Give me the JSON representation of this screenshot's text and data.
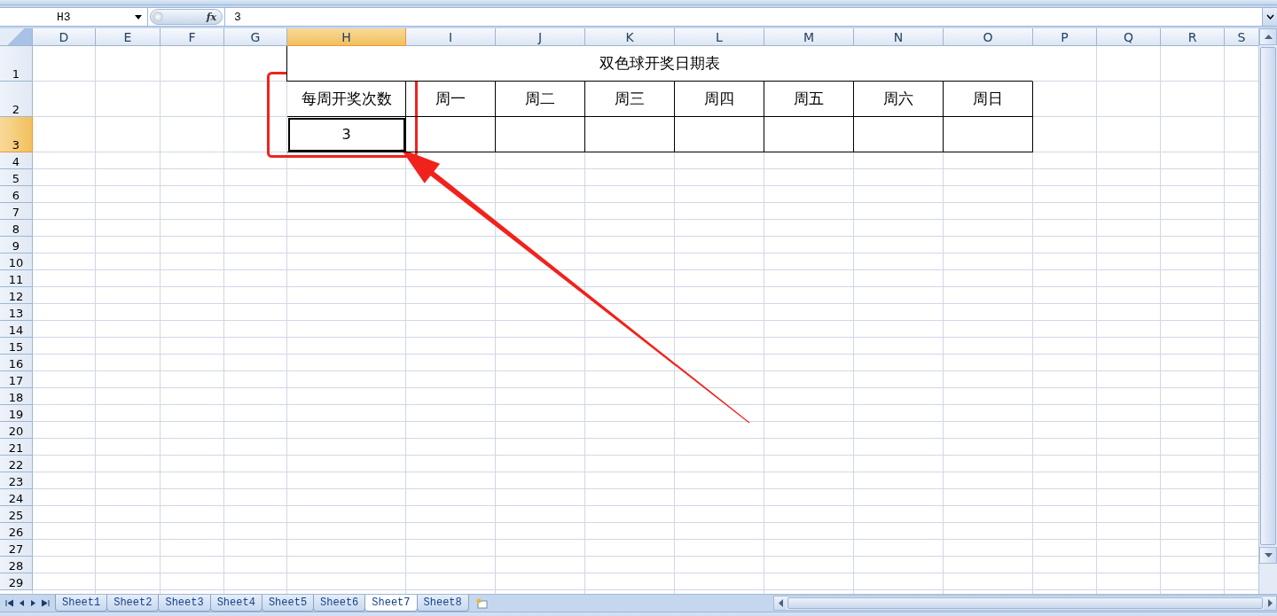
{
  "formula_bar": {
    "name_box": "H3",
    "function_label": "fx",
    "formula": "3"
  },
  "columns": [
    {
      "label": "D",
      "selected": false
    },
    {
      "label": "E",
      "selected": false
    },
    {
      "label": "F",
      "selected": false
    },
    {
      "label": "G",
      "selected": false
    },
    {
      "label": "H",
      "selected": true
    },
    {
      "label": "I",
      "selected": false
    },
    {
      "label": "J",
      "selected": false
    },
    {
      "label": "K",
      "selected": false
    },
    {
      "label": "L",
      "selected": false
    },
    {
      "label": "M",
      "selected": false
    },
    {
      "label": "N",
      "selected": false
    },
    {
      "label": "O",
      "selected": false
    },
    {
      "label": "P",
      "selected": false
    },
    {
      "label": "Q",
      "selected": false
    },
    {
      "label": "R",
      "selected": false
    },
    {
      "label": "S",
      "selected": false
    }
  ],
  "rows": [
    {
      "label": "1",
      "selected": false
    },
    {
      "label": "2",
      "selected": false
    },
    {
      "label": "3",
      "selected": true
    },
    {
      "label": "4",
      "selected": false
    },
    {
      "label": "5",
      "selected": false
    },
    {
      "label": "6",
      "selected": false
    },
    {
      "label": "7",
      "selected": false
    },
    {
      "label": "8",
      "selected": false
    },
    {
      "label": "9",
      "selected": false
    },
    {
      "label": "10",
      "selected": false
    },
    {
      "label": "11",
      "selected": false
    },
    {
      "label": "12",
      "selected": false
    },
    {
      "label": "13",
      "selected": false
    },
    {
      "label": "14",
      "selected": false
    },
    {
      "label": "15",
      "selected": false
    },
    {
      "label": "16",
      "selected": false
    },
    {
      "label": "17",
      "selected": false
    },
    {
      "label": "18",
      "selected": false
    },
    {
      "label": "19",
      "selected": false
    },
    {
      "label": "20",
      "selected": false
    },
    {
      "label": "21",
      "selected": false
    },
    {
      "label": "22",
      "selected": false
    },
    {
      "label": "23",
      "selected": false
    },
    {
      "label": "24",
      "selected": false
    },
    {
      "label": "25",
      "selected": false
    },
    {
      "label": "26",
      "selected": false
    },
    {
      "label": "27",
      "selected": false
    },
    {
      "label": "28",
      "selected": false
    },
    {
      "label": "29",
      "selected": false
    }
  ],
  "table": {
    "title": "双色球开奖日期表",
    "headers": [
      "每周开奖次数",
      "周一",
      "周二",
      "周三",
      "周四",
      "周五",
      "周六",
      "周日"
    ],
    "values": [
      {
        "text": "3",
        "selected": true
      }
    ]
  },
  "sheet_tabs": [
    {
      "label": "Sheet1",
      "selected": false
    },
    {
      "label": "Sheet2",
      "selected": false
    },
    {
      "label": "Sheet3",
      "selected": false
    },
    {
      "label": "Sheet4",
      "selected": false
    },
    {
      "label": "Sheet5",
      "selected": false
    },
    {
      "label": "Sheet6",
      "selected": false
    },
    {
      "label": "Sheet7",
      "selected": true
    },
    {
      "label": "Sheet8",
      "selected": false
    }
  ]
}
